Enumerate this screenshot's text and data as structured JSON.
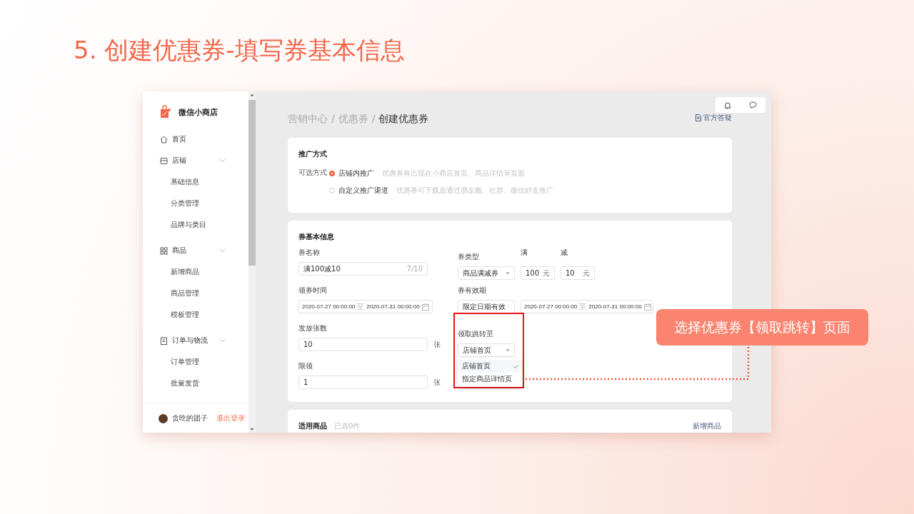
{
  "slide_title": "5. 创建优惠券-填写券基本信息",
  "sidebar": {
    "brand": "微信小商店",
    "sections": [
      {
        "label": "首页"
      },
      {
        "label": "店铺",
        "expanded": true,
        "children": [
          {
            "label": "基础信息"
          },
          {
            "label": "分类管理"
          },
          {
            "label": "品牌与类目"
          }
        ]
      },
      {
        "label": "商品",
        "expanded": true,
        "children": [
          {
            "label": "新增商品"
          },
          {
            "label": "商品管理"
          },
          {
            "label": "模板管理"
          }
        ]
      },
      {
        "label": "订单与物流",
        "expanded": true,
        "children": [
          {
            "label": "订单管理"
          },
          {
            "label": "批量发货"
          }
        ]
      }
    ],
    "user": {
      "name": "贪吃的团子",
      "logout": "退出登录"
    }
  },
  "breadcrumb": [
    {
      "label": "营销中心"
    },
    {
      "label": "优惠券"
    },
    {
      "label": "创建优惠券"
    }
  ],
  "breadcrumb_separator": "/",
  "help_link": "官方答疑",
  "promo_card": {
    "title": "推广方式",
    "label": "可选方式",
    "options": [
      {
        "label": "店铺内推广",
        "hint": "优惠券将出现在小商店首页、商品详情等页面",
        "selected": true
      },
      {
        "label": "自定义推广渠道",
        "hint": "优惠券可下载后通过朋友圈、社群、微信好友推广",
        "selected": false
      }
    ]
  },
  "basic_card": {
    "title": "券基本信息",
    "name": {
      "label": "券名称",
      "value": "满100减10",
      "count": "7/10"
    },
    "claim_time": {
      "label": "领券时间",
      "start": "2020-07-27 00:00:00",
      "separator": "至",
      "end": "2020-07-31 00:00:00"
    },
    "quantity": {
      "label": "发放张数",
      "value": "10",
      "unit": "张"
    },
    "limit": {
      "label": "限领",
      "value": "1",
      "unit": "张"
    },
    "type": {
      "label": "券类型",
      "value": "商品满减券"
    },
    "threshold": {
      "label": "满",
      "value": "100",
      "unit": "元"
    },
    "discount": {
      "label": "减",
      "value": "10",
      "unit": "元"
    },
    "validity": {
      "label": "券有效期",
      "mode": "限定日期有效",
      "start": "2020-07-27 00:00:00",
      "separator": "至",
      "end": "2020-07-31 00:00:00"
    },
    "jump": {
      "label": "领取跳转至",
      "value": "店铺首页",
      "options": [
        {
          "label": "店铺首页",
          "selected": true
        },
        {
          "label": "指定商品详情页",
          "selected": false
        }
      ]
    }
  },
  "goods_card": {
    "title": "适用商品",
    "count": "已选0件",
    "action": "新增商品"
  },
  "callout": "选择优惠券【领取跳转】页面"
}
